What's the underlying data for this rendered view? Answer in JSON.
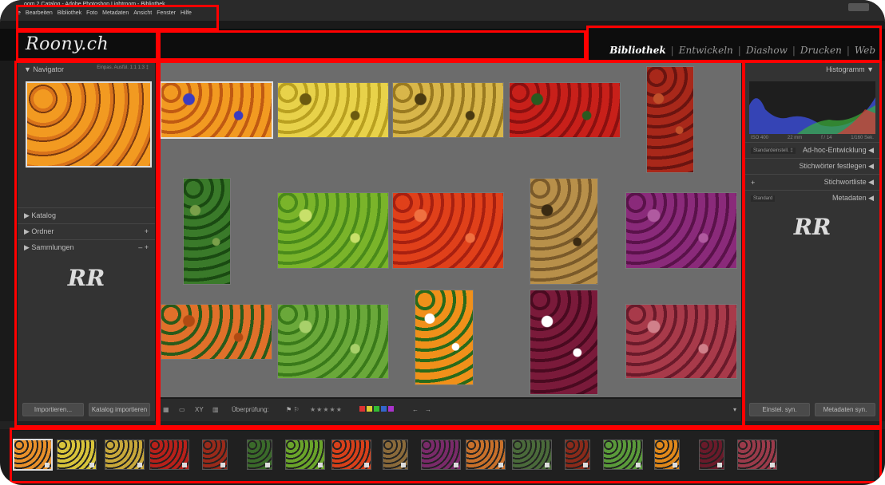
{
  "window": {
    "title": "oom 2 Catalog - Adobe Photoshop Lightroom - Bibliothek",
    "menu": [
      "e",
      "Bearbeiten",
      "Bibliothek",
      "Foto",
      "Metadaten",
      "Ansicht",
      "Fenster",
      "Hilfe"
    ]
  },
  "header": {
    "logo": "Roony.ch",
    "modules": [
      "Bibliothek",
      "Entwickeln",
      "Diashow",
      "Drucken",
      "Web"
    ],
    "active_module": "Bibliothek"
  },
  "left_panel": {
    "navigator": {
      "label": "Navigator",
      "zoom_options": [
        "Einpas.",
        "Ausfül.",
        "1:1",
        "1:3 ‡"
      ]
    },
    "items": [
      "Katalog",
      "Ordner",
      "Sammlungen"
    ],
    "logo": "RR",
    "buttons": [
      "Importieren...",
      "Katalog importieren"
    ]
  },
  "right_panel": {
    "histogram_label": "Histogramm",
    "histogram_info": [
      "ISO 400",
      "22 mm",
      "f / 14",
      "1/160 Sek."
    ],
    "sections": [
      {
        "label": "Ad-hoc-Entwicklung",
        "preset": "Standardeinstell. ‡"
      },
      {
        "label": "Stichwörter festlegen",
        "preset": ""
      },
      {
        "label": "Stichwortliste",
        "preset": ""
      },
      {
        "label": "Metadaten",
        "preset": "Standard"
      }
    ],
    "logo": "RR",
    "buttons": [
      "Einstel. syn.",
      "Metadaten syn."
    ]
  },
  "toolbar": {
    "review_label": "Überprüfung:",
    "stars": "★★★★★",
    "color_labels": [
      "#d33",
      "#dc3",
      "#3b3",
      "#36c",
      "#a3c"
    ]
  },
  "grid": {
    "photos": [
      {
        "name": "oranges-with-wrappers",
        "colors": [
          "#f29a21",
          "#c05a12",
          "#3b3cc0"
        ]
      },
      {
        "name": "yellow-apples",
        "colors": [
          "#e8d24a",
          "#b9a020",
          "#6b5a10"
        ]
      },
      {
        "name": "pears",
        "colors": [
          "#d8b64a",
          "#9a7a20",
          "#4a3a10"
        ]
      },
      {
        "name": "tomatoes-on-vine",
        "colors": [
          "#c8201a",
          "#8a1010",
          "#2a5a20"
        ]
      },
      {
        "name": "dried-chilies",
        "colors": [
          "#a8281a",
          "#6a1410",
          "#c0502a"
        ]
      },
      {
        "name": "broccoli-rabe",
        "colors": [
          "#3a7a2a",
          "#1a4a12",
          "#7aa04a"
        ]
      },
      {
        "name": "green-peppers",
        "colors": [
          "#7ab42a",
          "#4a8a1a",
          "#c8e06a"
        ]
      },
      {
        "name": "red-tomatoes",
        "colors": [
          "#e0401a",
          "#a82010",
          "#f07040"
        ]
      },
      {
        "name": "potatoes",
        "colors": [
          "#b8904a",
          "#7a5a2a",
          "#3a2a12"
        ]
      },
      {
        "name": "red-onions",
        "colors": [
          "#8a2a7a",
          "#5a124a",
          "#b05aa0"
        ]
      },
      {
        "name": "carrots",
        "colors": [
          "#e0702a",
          "#2a5a1a",
          "#b04a12"
        ]
      },
      {
        "name": "lettuce",
        "colors": [
          "#6aa83a",
          "#3a7a1a",
          "#a8d06a"
        ]
      },
      {
        "name": "oranges-sign",
        "colors": [
          "#f0901a",
          "#2a6a1a",
          "#ffffff"
        ]
      },
      {
        "name": "red-onions-sign",
        "colors": [
          "#7a1a3a",
          "#4a0a20",
          "#ffffff"
        ]
      },
      {
        "name": "borlotti-beans",
        "colors": [
          "#a83a4a",
          "#6a1a2a",
          "#d0808a"
        ]
      }
    ]
  },
  "filmstrip": {
    "frames": [
      {
        "name": "oranges",
        "color": "#e8902a"
      },
      {
        "name": "apples",
        "color": "#d8c43a"
      },
      {
        "name": "pears",
        "color": "#c8a83a"
      },
      {
        "name": "tomatoes-vine",
        "color": "#b8201a"
      },
      {
        "name": "chilies",
        "color": "#9a2a1a"
      },
      {
        "name": "broccoli",
        "color": "#3a6a2a"
      },
      {
        "name": "peppers",
        "color": "#6aa42a"
      },
      {
        "name": "tomatoes",
        "color": "#d8401a"
      },
      {
        "name": "potatoes",
        "color": "#8a6a3a"
      },
      {
        "name": "onions",
        "color": "#7a2a6a"
      },
      {
        "name": "carrots",
        "color": "#c8702a"
      },
      {
        "name": "beans-green",
        "color": "#4a6a3a"
      },
      {
        "name": "chilies-2",
        "color": "#8a2a1a"
      },
      {
        "name": "lettuce",
        "color": "#5a9a3a"
      },
      {
        "name": "oranges-2",
        "color": "#e0881a"
      },
      {
        "name": "onions-2",
        "color": "#6a1a2a"
      },
      {
        "name": "borlotti",
        "color": "#9a3a4a"
      }
    ]
  }
}
